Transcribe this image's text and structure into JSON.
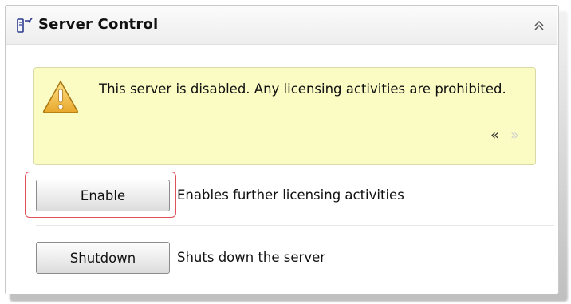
{
  "panel": {
    "title": "Server Control",
    "header_icon": "server-control-icon",
    "collapse_icon": "double-chevron-up-icon"
  },
  "alert": {
    "icon": "warning-icon",
    "message": "This server is disabled. Any licensing activities are prohibited.",
    "prev_symbol": "«",
    "next_symbol": "»"
  },
  "actions": [
    {
      "label": "Enable",
      "description": "Enables further licensing activities",
      "highlighted": true
    },
    {
      "label": "Shutdown",
      "description": "Shuts down the server",
      "highlighted": false
    }
  ],
  "colors": {
    "alert_background": "#fbfcc3",
    "highlight_border": "#e0525a"
  }
}
